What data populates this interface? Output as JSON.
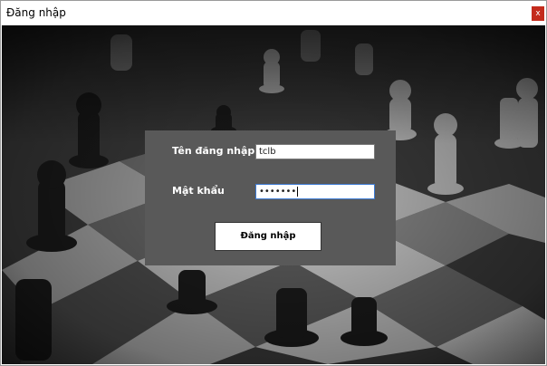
{
  "window": {
    "title": "Đăng nhập",
    "close_label": "x"
  },
  "login": {
    "username_label": "Tên đăng nhập",
    "username_value": "tclb",
    "password_label": "Mật khẩu",
    "password_value": "•••••••",
    "submit_label": "Đăng nhập"
  },
  "colors": {
    "panel": "#595959",
    "close_button": "#c42b1c"
  },
  "background": {
    "icon": "chessboard-photo"
  }
}
